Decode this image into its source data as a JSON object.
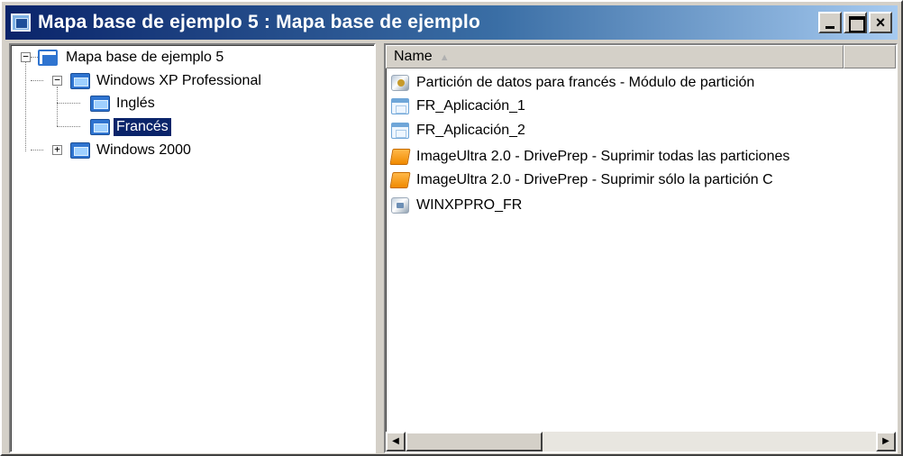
{
  "window": {
    "title": "Mapa base de ejemplo 5 : Mapa base de ejemplo",
    "controls": {
      "minimize": "minimize",
      "maximize": "maximize",
      "close": "×"
    }
  },
  "tree": {
    "root": {
      "label": "Mapa base de ejemplo 5",
      "expander": "−",
      "icon": "base-map-icon"
    },
    "os_xp": {
      "label": "Windows XP Professional",
      "expander": "−",
      "icon": "os-node-icon"
    },
    "lang_en": {
      "label": "Inglés",
      "icon": "language-node-icon"
    },
    "lang_fr": {
      "label": "Francés",
      "icon": "language-node-icon",
      "selected": true
    },
    "os_2000": {
      "label": "Windows 2000",
      "expander": "+",
      "icon": "os-node-icon"
    }
  },
  "list": {
    "column_name": "Name",
    "sort_indicator": "▲",
    "items": [
      {
        "label": "Partición de datos para francés  - Módulo de partición",
        "icon": "partition-module-icon"
      },
      {
        "label": "FR_Aplicación_1",
        "icon": "application-icon"
      },
      {
        "label": "FR_Aplicación_2",
        "icon": "application-icon"
      },
      {
        "label": "ImageUltra 2.0 - DrivePrep - Suprimir todas las particiones",
        "icon": "driveprep-icon"
      },
      {
        "label": "ImageUltra 2.0 - DrivePrep - Suprimir sólo la partición C",
        "icon": "driveprep-icon"
      },
      {
        "label": "WINXPPRO_FR",
        "icon": "os-image-icon"
      }
    ]
  },
  "scrollbar": {
    "left_arrow": "◀",
    "right_arrow": "▶"
  },
  "colors": {
    "title_gradient_start": "#0a246a",
    "title_gradient_end": "#a6caf0",
    "selection": "#0a246a",
    "chrome": "#d4d0c8"
  }
}
